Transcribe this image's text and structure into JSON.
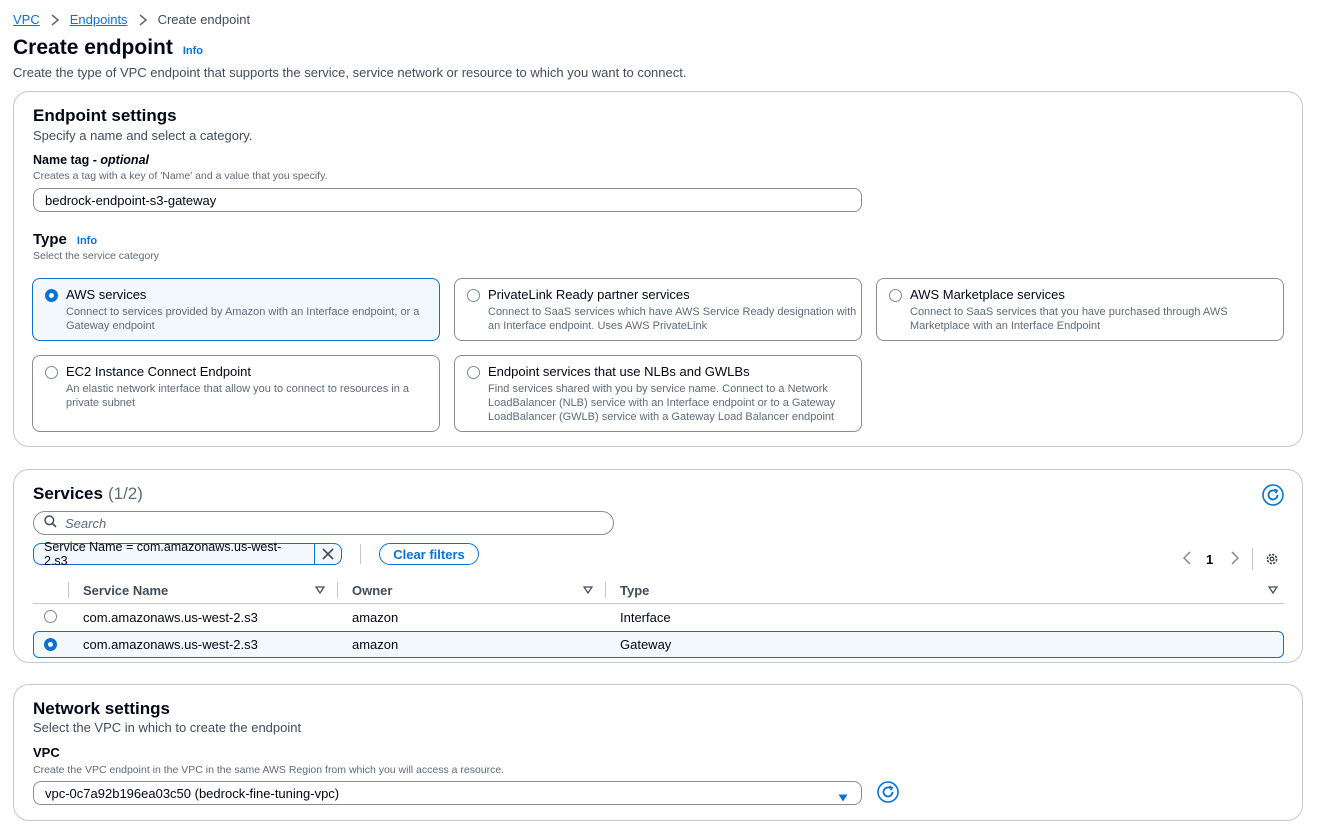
{
  "breadcrumb": {
    "vpc": "VPC",
    "endpoints": "Endpoints",
    "current": "Create endpoint"
  },
  "page": {
    "title": "Create endpoint",
    "info": "Info",
    "description": "Create the type of VPC endpoint that supports the service, service network or resource to which you want to connect."
  },
  "endpoint_settings": {
    "title": "Endpoint settings",
    "description": "Specify a name and select a category.",
    "name_label": "Name tag - ",
    "name_optional": "optional",
    "name_constraint": "Creates a tag with a key of 'Name' and a value that you specify.",
    "name_value": "bedrock-endpoint-s3-gateway",
    "type_label": "Type",
    "type_info": "Info",
    "type_description": "Select the service category",
    "tiles": [
      {
        "title": "AWS services",
        "desc": "Connect to services provided by Amazon with an Interface endpoint, or a Gateway endpoint",
        "selected": true
      },
      {
        "title": "PrivateLink Ready partner services",
        "desc": "Connect to SaaS services which have AWS Service Ready designation with an Interface endpoint. Uses AWS PrivateLink",
        "selected": false
      },
      {
        "title": "AWS Marketplace services",
        "desc": "Connect to SaaS services that you have purchased through AWS Marketplace with an Interface Endpoint",
        "selected": false
      },
      {
        "title": "EC2 Instance Connect Endpoint",
        "desc": "An elastic network interface that allow you to connect to resources in a private subnet",
        "selected": false
      },
      {
        "title": "Endpoint services that use NLBs and GWLBs",
        "desc": "Find services shared with you by service name. Connect to a Network LoadBalancer (NLB) service with an Interface endpoint or to a Gateway LoadBalancer (GWLB) service with a Gateway Load Balancer endpoint",
        "selected": false
      }
    ]
  },
  "services": {
    "title": "Services",
    "count": "(1/2)",
    "search_placeholder": "Search",
    "filter_token": "Service Name = com.amazonaws.us-west-2.s3",
    "clear_filters": "Clear filters",
    "page_number": "1",
    "columns": [
      "Service Name",
      "Owner",
      "Type"
    ],
    "rows": [
      {
        "service_name": "com.amazonaws.us-west-2.s3",
        "owner": "amazon",
        "type": "Interface",
        "selected": false
      },
      {
        "service_name": "com.amazonaws.us-west-2.s3",
        "owner": "amazon",
        "type": "Gateway",
        "selected": true
      }
    ]
  },
  "network_settings": {
    "title": "Network settings",
    "description": "Select the VPC in which to create the endpoint",
    "vpc_label": "VPC",
    "vpc_constraint": "Create the VPC endpoint in the VPC in the same AWS Region from which you will access a resource.",
    "vpc_value": "vpc-0c7a92b196ea03c50 (bedrock-fine-tuning-vpc)"
  },
  "colors": {
    "accent": "#0972d3",
    "text": "#000716",
    "secondary": "#414d5c",
    "border": "#c6c6cd"
  },
  "icons": [
    "chevron-right-icon",
    "search-icon",
    "close-icon",
    "refresh-icon",
    "chevron-left-icon",
    "gear-icon",
    "caret-down-icon"
  ]
}
